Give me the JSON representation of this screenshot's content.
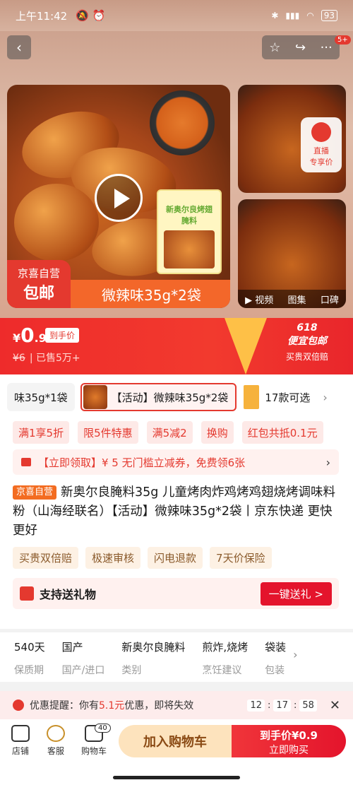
{
  "status": {
    "time": "上午11:42",
    "battery": "93"
  },
  "gallery": {
    "overlay_badge_1": "京喜自营",
    "overlay_badge_2": "包邮",
    "overlay_flavor": "微辣味35g*2袋",
    "package_text": "新奥尔良烤翅腌料",
    "live_label_1": "直播",
    "live_label_2": "专享价",
    "tabs": [
      "视频",
      "图集",
      "口碑"
    ]
  },
  "more_badge": "5+",
  "price": {
    "symbol": "¥",
    "int": "0",
    "dec": ".9",
    "tag": "到手价",
    "old": "¥6",
    "sold": "已售5万+",
    "promo_t1": "618",
    "promo_t2": "便宜包邮",
    "promo_t3": "买贵双倍赔"
  },
  "sku": {
    "first": "味35g*1袋",
    "selected": "【活动】微辣味35g*2袋",
    "more": "17款可选"
  },
  "coupons": [
    "满1享5折",
    "限5件特惠",
    "满5减2",
    "换购",
    "红包共抵0.1元"
  ],
  "get_coupon": "【立即领取】¥ 5 无门槛立减券，免费领6张",
  "title": {
    "badge": "京喜自营",
    "text": "新奥尔良腌料35g 儿童烤肉炸鸡烤鸡翅烧烤调味料粉（山海经联名）【活动】微辣味35g*2袋丨京东快递 更快更好"
  },
  "services": [
    "买贵双倍赔",
    "极速审核",
    "闪电退款",
    "7天价保险"
  ],
  "gift": {
    "label": "支持送礼物",
    "button": "一键送礼 >"
  },
  "specs": [
    {
      "v": "540天",
      "k": "保质期"
    },
    {
      "v": "国产",
      "k": "国产/进口"
    },
    {
      "v": "新奥尔良腌料",
      "k": "类别"
    },
    {
      "v": "煎炸,烧烤",
      "k": "烹饪建议"
    },
    {
      "v": "袋装",
      "k": "包装"
    }
  ],
  "remind": {
    "prefix": "优惠提醒：你有",
    "amount": "5.1元",
    "suffix": "优惠，即将失效",
    "h": "12",
    "m": "17",
    "s": "58"
  },
  "bottom": {
    "store": "店铺",
    "service": "客服",
    "cart": "购物车",
    "cart_count": "40",
    "add_cart": "加入购物车",
    "buy_price": "到手价¥0.9",
    "buy_now": "立即购买"
  }
}
